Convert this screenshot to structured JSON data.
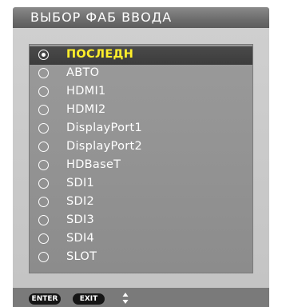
{
  "title": "ВЫБОР ФАБ ВВОДА",
  "inputs": [
    {
      "label": "ПОСЛЕДН",
      "selected": true
    },
    {
      "label": "АВТО",
      "selected": false
    },
    {
      "label": "HDMI1",
      "selected": false
    },
    {
      "label": "HDMI2",
      "selected": false
    },
    {
      "label": "DisplayPort1",
      "selected": false
    },
    {
      "label": "DisplayPort2",
      "selected": false
    },
    {
      "label": "HDBaseT",
      "selected": false
    },
    {
      "label": "SDI1",
      "selected": false
    },
    {
      "label": "SDI2",
      "selected": false
    },
    {
      "label": "SDI3",
      "selected": false
    },
    {
      "label": "SDI4",
      "selected": false
    },
    {
      "label": "SLOT",
      "selected": false
    }
  ],
  "footer": {
    "enter_label": "ENTER",
    "exit_label": "EXIT",
    "nav_icon": "up-down-arrows-icon"
  },
  "colors": {
    "selected_text": "#ffef2a",
    "title_bar": "#6e6e6e",
    "list_background": "#929292",
    "selection_bar": "#444444"
  }
}
